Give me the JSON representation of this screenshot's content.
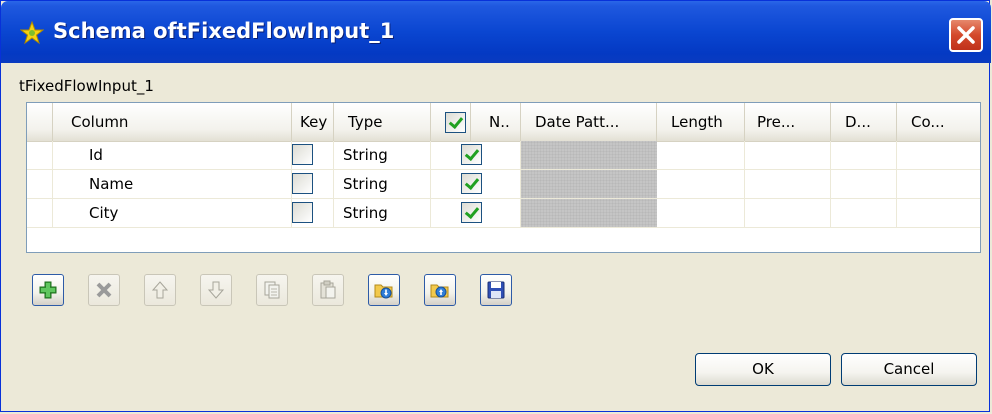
{
  "window": {
    "title": "Schema oftFixedFlowInput_1",
    "close_label": "×"
  },
  "subtitle": "tFixedFlowInput_1",
  "grid": {
    "columns": [
      "Column",
      "Key",
      "Type",
      "",
      "N..",
      "Date Patt...",
      "Length",
      "Pre...",
      "D...",
      "Co..."
    ],
    "rows": [
      {
        "column": "Id",
        "key": false,
        "type": "String",
        "nullable": true
      },
      {
        "column": "Name",
        "key": false,
        "type": "String",
        "nullable": true
      },
      {
        "column": "City",
        "key": false,
        "type": "String",
        "nullable": true
      }
    ]
  },
  "toolbar": {
    "buttons": [
      {
        "icon": "plus-icon",
        "enabled": true
      },
      {
        "icon": "delete-icon",
        "enabled": false
      },
      {
        "icon": "arrow-up-icon",
        "enabled": false
      },
      {
        "icon": "arrow-down-icon",
        "enabled": false
      },
      {
        "icon": "copy-icon",
        "enabled": false
      },
      {
        "icon": "paste-icon",
        "enabled": false
      },
      {
        "icon": "import-icon",
        "enabled": true
      },
      {
        "icon": "export-icon",
        "enabled": true
      },
      {
        "icon": "save-icon",
        "enabled": true
      }
    ]
  },
  "buttons": {
    "ok": "OK",
    "cancel": "Cancel"
  },
  "colors": {
    "titlebar": "#0a46d1",
    "close": "#d4492b",
    "check": "#21a121"
  }
}
